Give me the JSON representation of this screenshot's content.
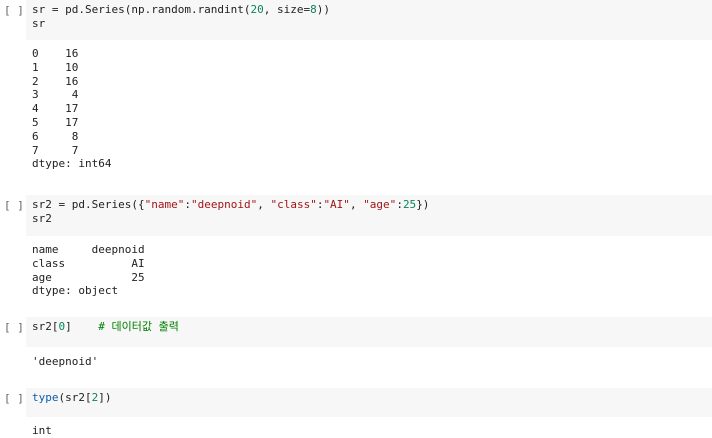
{
  "cells": [
    {
      "run_label": "[ ]",
      "code": [
        [
          {
            "t": "sr = pd.Series(np.random.randint(",
            "c": ""
          },
          {
            "t": "20",
            "c": "num"
          },
          {
            "t": ", size=",
            "c": ""
          },
          {
            "t": "8",
            "c": "num"
          },
          {
            "t": "))",
            "c": ""
          }
        ],
        [
          {
            "t": "sr",
            "c": ""
          }
        ]
      ],
      "output": [
        "0    16",
        "1    10",
        "2    16",
        "3     4",
        "4    17",
        "5    17",
        "6     8",
        "7     7",
        "dtype: int64"
      ]
    },
    {
      "run_label": "[ ]",
      "code": [
        [
          {
            "t": "sr2 = pd.Series({",
            "c": ""
          },
          {
            "t": "\"name\"",
            "c": "str"
          },
          {
            "t": ":",
            "c": ""
          },
          {
            "t": "\"deepnoid\"",
            "c": "str"
          },
          {
            "t": ", ",
            "c": ""
          },
          {
            "t": "\"class\"",
            "c": "str"
          },
          {
            "t": ":",
            "c": ""
          },
          {
            "t": "\"AI\"",
            "c": "str"
          },
          {
            "t": ", ",
            "c": ""
          },
          {
            "t": "\"age\"",
            "c": "str"
          },
          {
            "t": ":",
            "c": ""
          },
          {
            "t": "25",
            "c": "num"
          },
          {
            "t": "})",
            "c": ""
          }
        ],
        [
          {
            "t": "sr2",
            "c": ""
          }
        ]
      ],
      "output": [
        "name     deepnoid",
        "class          AI",
        "age            25",
        "dtype: object"
      ]
    },
    {
      "run_label": "[ ]",
      "code": [
        [
          {
            "t": "sr2[",
            "c": ""
          },
          {
            "t": "0",
            "c": "num"
          },
          {
            "t": "]    ",
            "c": ""
          },
          {
            "t": "# 데이터값 출력",
            "c": "cmt"
          }
        ]
      ],
      "output": [
        "'deepnoid'"
      ]
    },
    {
      "run_label": "[ ]",
      "code": [
        [
          {
            "t": "type",
            "c": "fn"
          },
          {
            "t": "(sr2[",
            "c": ""
          },
          {
            "t": "2",
            "c": "num"
          },
          {
            "t": "])",
            "c": ""
          }
        ]
      ],
      "output": [
        "int"
      ]
    }
  ]
}
